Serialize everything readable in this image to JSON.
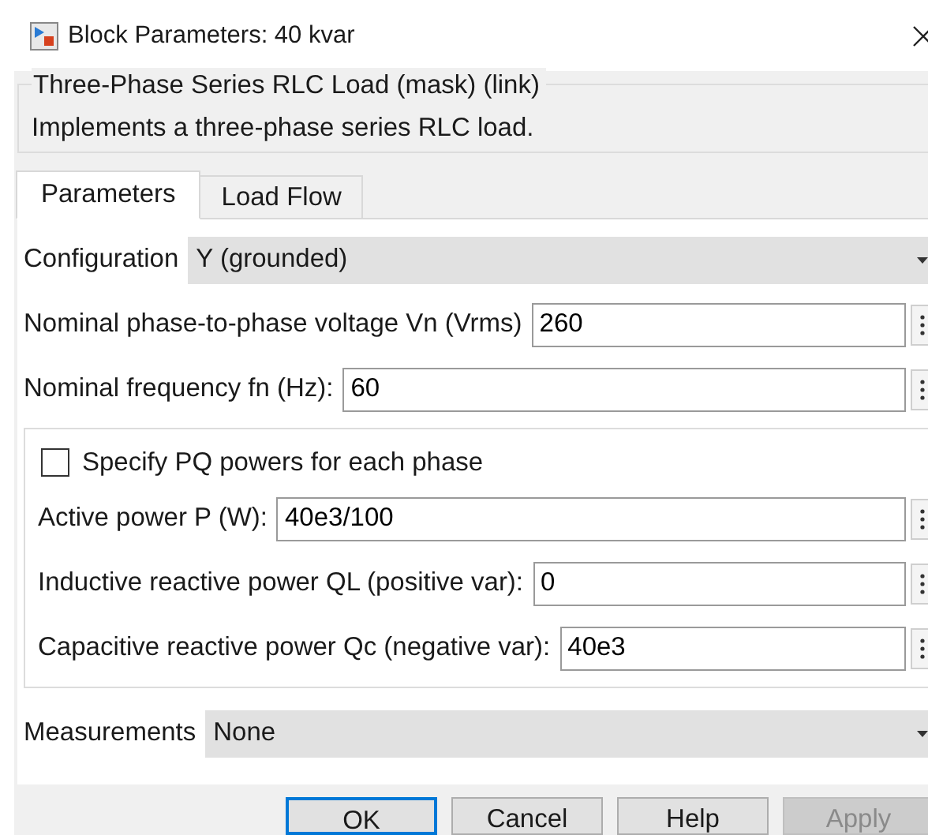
{
  "window": {
    "title": "Block Parameters: 40 kvar"
  },
  "header": {
    "title": "Three-Phase Series RLC Load (mask) (link)",
    "description": "Implements a three-phase series RLC load."
  },
  "tabs": [
    {
      "label": "Parameters",
      "selected": true
    },
    {
      "label": "Load Flow",
      "selected": false
    }
  ],
  "fields": [
    {
      "kind": "dropdown",
      "label": "Configuration",
      "value": "Y (grounded)"
    },
    {
      "kind": "text",
      "label": "Nominal phase-to-phase voltage Vn (Vrms)",
      "value": "260"
    },
    {
      "kind": "text",
      "label": "Nominal frequency fn (Hz):",
      "value": "60"
    }
  ],
  "group": {
    "checkbox": {
      "label": "Specify PQ powers for each phase",
      "checked": false
    },
    "fields": [
      {
        "kind": "text",
        "label": "Active power P (W):",
        "value": "40e3/100"
      },
      {
        "kind": "text",
        "label": "Inductive reactive power QL (positive var):",
        "value": "0"
      },
      {
        "kind": "text",
        "label": "Capacitive reactive power Qc (negative var):",
        "value": "40e3"
      }
    ]
  },
  "after_fields": [
    {
      "kind": "dropdown",
      "label": "Measurements",
      "value": "None"
    }
  ],
  "buttons": [
    {
      "label": "OK",
      "default": true,
      "disabled": false
    },
    {
      "label": "Cancel",
      "default": false,
      "disabled": false
    },
    {
      "label": "Help",
      "default": false,
      "disabled": false
    },
    {
      "label": "Apply",
      "default": false,
      "disabled": true
    }
  ]
}
